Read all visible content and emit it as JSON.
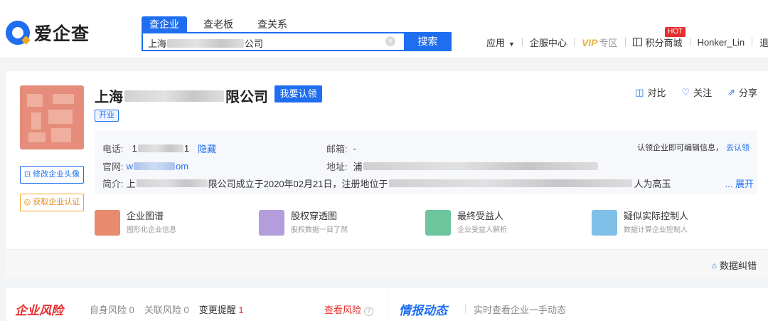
{
  "header": {
    "logo_text": "爱企查",
    "search_tabs": [
      "查企业",
      "查老板",
      "查关系"
    ],
    "search": {
      "prefix": "上海",
      "suffix": "公司",
      "button": "搜索",
      "clear": "×"
    },
    "nav": {
      "app": "应用",
      "service": "企服中心",
      "vip_mark": "VIP",
      "vip_text": "专区",
      "points": "积分商城",
      "hot": "HOT",
      "user": "Honker_Lin",
      "logout": "退出"
    }
  },
  "company": {
    "name_prefix": "上海",
    "name_suffix": "限公司",
    "claim": "我要认领",
    "status": "开业",
    "actions": {
      "compare": "对比",
      "follow": "关注",
      "share": "分享"
    },
    "side_buttons": {
      "edit_avatar": "修改企业头像",
      "certify": "获取企业认证"
    },
    "info": {
      "phone_label": "电话:",
      "phone_prefix": "1",
      "phone_suffix": "1",
      "hide": "隐藏",
      "email_label": "邮箱:",
      "email": "-",
      "edit_hint": "认领企业即可编辑信息，",
      "edit_link": "去认领",
      "website_label": "官网:",
      "website_prefix": "w",
      "website_suffix": "om",
      "address_label": "地址:",
      "address_prefix": "浦",
      "intro_label": "简介:",
      "intro_a": "上",
      "intro_b": "限公司成立于2020年02月21日，注册地位于",
      "intro_c": "人为高玉",
      "intro_more": "... 展开"
    },
    "features": [
      {
        "title": "企业图谱",
        "subtitle": "图形化企业信息",
        "color": "#e88a6e"
      },
      {
        "title": "股权穿透图",
        "subtitle": "股权数据一目了然",
        "color": "#b39ddb"
      },
      {
        "title": "最终受益人",
        "subtitle": "企业受益人解析",
        "color": "#6cc59d"
      },
      {
        "title": "疑似实际控制人",
        "subtitle": "数据计算企业控制人",
        "color": "#7fbfe8"
      }
    ],
    "data_fix": "数据纠错"
  },
  "risk_bar": {
    "title": "企业风险",
    "items": [
      {
        "label": "自身风险",
        "count": "0"
      },
      {
        "label": "关联风险",
        "count": "0"
      },
      {
        "label": "变更提醒",
        "count": "1"
      }
    ],
    "check": "查看风险",
    "intel_title": "情报动态",
    "intel_sub": "实时查看企业一手动态"
  },
  "colors": {
    "brand_blue": "#1f6ef0",
    "risk_red": "#e62d2d",
    "vip_gold": "#e8b04a",
    "certify_orange": "#f5a623"
  }
}
